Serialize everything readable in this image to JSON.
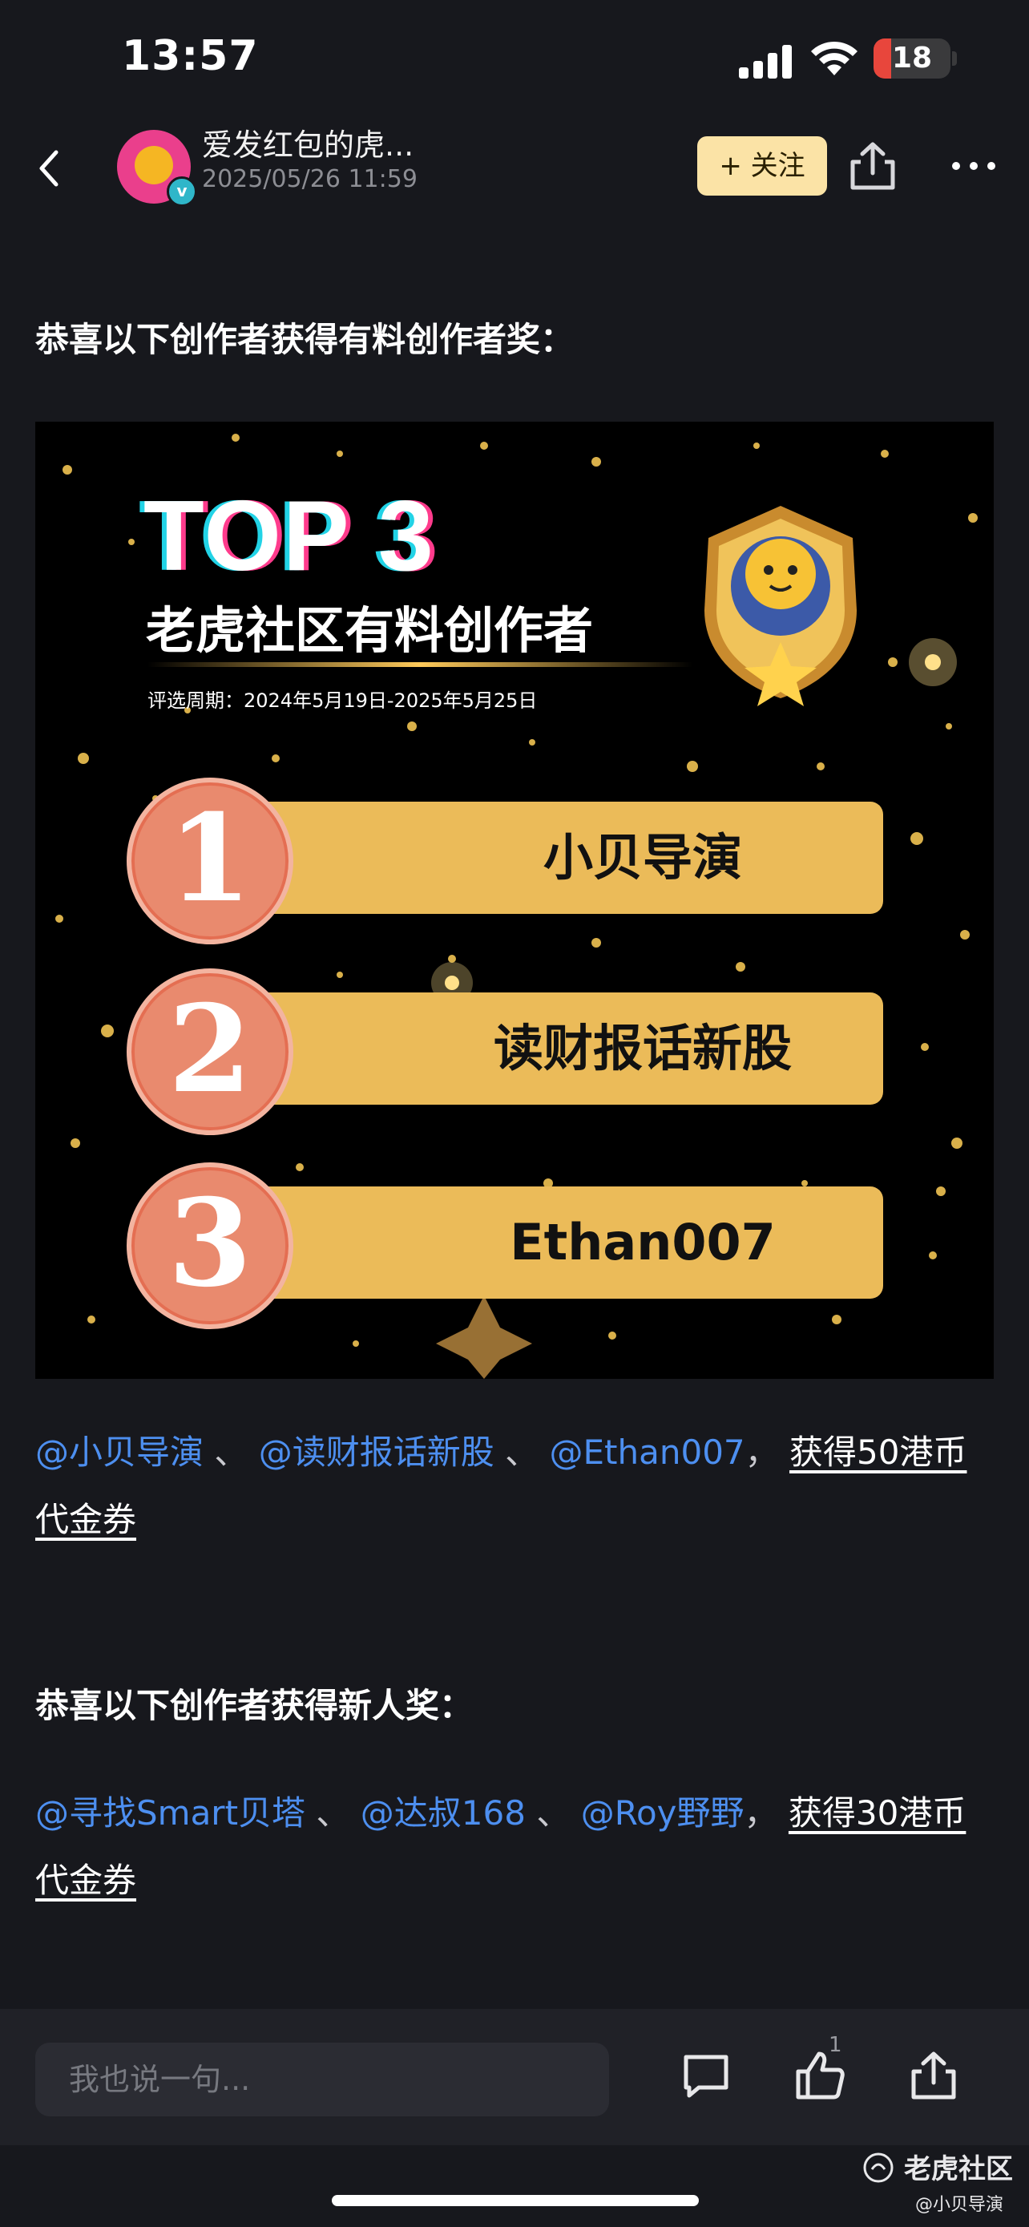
{
  "status_bar": {
    "time": "13:57",
    "battery": "18",
    "battery_color": "#e8463c"
  },
  "header": {
    "author_name": "爱发红包的虎...",
    "post_date": "2025/05/26 11:59",
    "follow_label": "+ 关注",
    "back_icon": "chevron-left-icon",
    "share_icon": "share-icon",
    "more_icon": "more-dots-icon"
  },
  "post": {
    "heading_1": "恭喜以下创作者获得有料创作者奖：",
    "banner": {
      "title": "TOP 3",
      "subtitle": "老虎社区有料创作者",
      "period": "评选周期：2024年5月19日-2025年5月25日",
      "ranks": [
        {
          "number": "1",
          "name": "小贝导演"
        },
        {
          "number": "2",
          "name": "读财报话新股"
        },
        {
          "number": "3",
          "name": "Ethan007"
        }
      ]
    },
    "winners_1": {
      "mentions": [
        "@小贝导演",
        "@读财报话新股",
        "@Ethan007"
      ],
      "separator": "、",
      "comma": "，",
      "reward": "获得50港币代金券"
    },
    "heading_2": "恭喜以下创作者获得新人奖：",
    "winners_2": {
      "mentions": [
        "@寻找Smart贝塔",
        "@达叔168",
        "@Roy野野"
      ],
      "separator": "、",
      "comma": "，",
      "reward": "获得30港币代金券"
    }
  },
  "bottom_bar": {
    "comment_placeholder": "我也说一句...",
    "like_count": "1"
  },
  "watermark": {
    "brand": "老虎社区",
    "user": "@小贝导演"
  },
  "colors": {
    "mention": "#4d8ff0",
    "follow_bg": "#fbe3a6",
    "rank_bar": "#ebbb59",
    "rank_circle": "#e98a6e"
  }
}
